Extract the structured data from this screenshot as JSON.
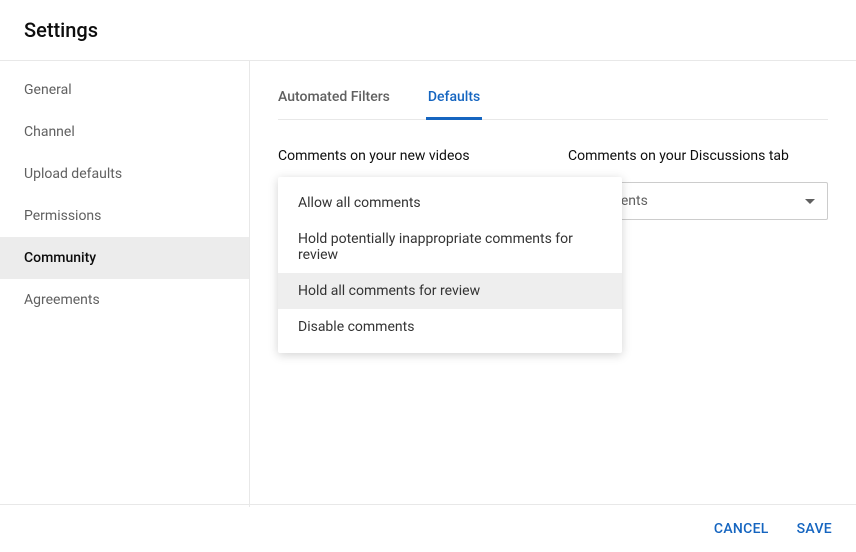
{
  "header": {
    "title": "Settings"
  },
  "sidebar": {
    "items": [
      {
        "label": "General",
        "active": false
      },
      {
        "label": "Channel",
        "active": false
      },
      {
        "label": "Upload defaults",
        "active": false
      },
      {
        "label": "Permissions",
        "active": false
      },
      {
        "label": "Community",
        "active": true
      },
      {
        "label": "Agreements",
        "active": false
      }
    ]
  },
  "tabs": [
    {
      "label": "Automated Filters",
      "active": false
    },
    {
      "label": "Defaults",
      "active": true
    }
  ],
  "sections": {
    "new_videos": {
      "label": "Comments on your new videos",
      "dropdown_open": true,
      "options": [
        {
          "label": "Allow all comments",
          "highlighted": false
        },
        {
          "label": "Hold potentially inappropriate comments for review",
          "highlighted": false
        },
        {
          "label": "Hold all comments for review",
          "highlighted": true
        },
        {
          "label": "Disable comments",
          "highlighted": false
        }
      ]
    },
    "discussions": {
      "label": "Comments on your Discussions tab",
      "selected_visible_text": "comments"
    }
  },
  "footer": {
    "cancel": "CANCEL",
    "save": "SAVE"
  }
}
